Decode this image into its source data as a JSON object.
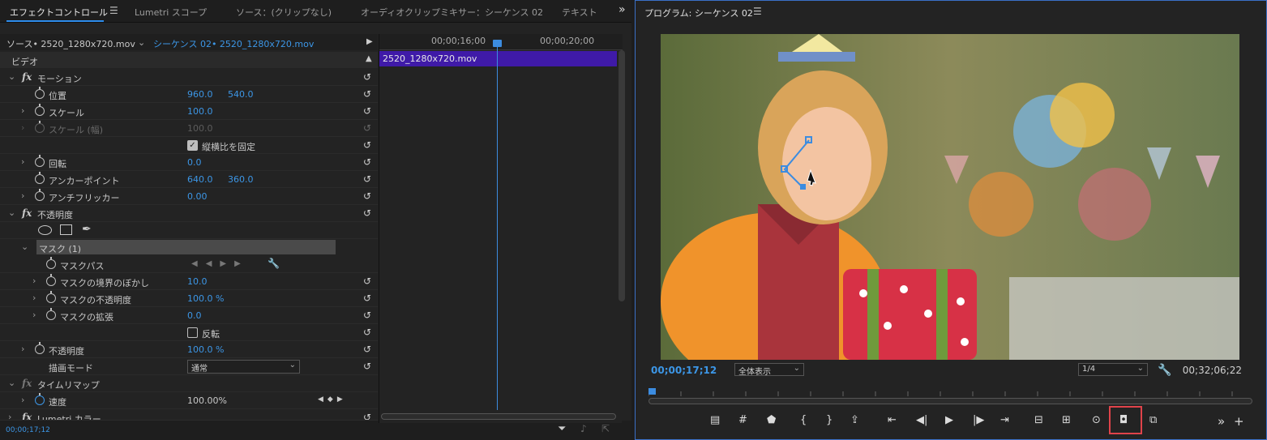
{
  "tabs": {
    "effect_controls": "エフェクトコントロール",
    "lumetri_scope": "Lumetri スコープ",
    "source": "ソース：(クリップなし)",
    "audio_mixer": "オーディオクリップミキサー：シーケンス 02",
    "text": "テキスト",
    "more": "»"
  },
  "source_row": {
    "source": "ソース• 2520_1280x720.mov",
    "sequence": "シーケンス 02• 2520_1280x720.mov"
  },
  "video_header": "ビデオ",
  "params": {
    "motion": "モーション",
    "position": "位置",
    "position_x": "960.0",
    "position_y": "540.0",
    "scale": "スケール",
    "scale_val": "100.0",
    "scale_width": "スケール (幅)",
    "scale_width_val": "100.0",
    "uniform_scale": "縦横比を固定",
    "rotation": "回転",
    "rotation_val": "0.0",
    "anchor": "アンカーポイント",
    "anchor_x": "640.0",
    "anchor_y": "360.0",
    "anti_flicker": "アンチフリッカー",
    "anti_flicker_val": "0.00",
    "opacity_group": "不透明度",
    "mask": "マスク (1)",
    "mask_path": "マスクパス",
    "mask_feather": "マスクの境界のぼかし",
    "mask_feather_val": "10.0",
    "mask_opacity": "マスクの不透明度",
    "mask_opacity_val": "100.0 %",
    "mask_expansion": "マスクの拡張",
    "mask_expansion_val": "0.0",
    "inverted": "反転",
    "opacity": "不透明度",
    "opacity_val": "100.0 %",
    "blend_mode": "描画モード",
    "blend_mode_val": "通常",
    "time_remap": "タイムリマップ",
    "speed": "速度",
    "speed_val": "100.00%",
    "lumetri": "Lumetri カラー"
  },
  "timeline": {
    "tc1": "00;00;16;00",
    "tc2": "00;00;20;00",
    "clip": "2520_1280x720.mov"
  },
  "bottom_timecode": "00;00;17;12",
  "monitor": {
    "title": "プログラム: シーケンス 02",
    "current_tc": "00;00;17;12",
    "zoom": "全体表示",
    "resolution": "1/4",
    "duration": "00;32;06;22"
  },
  "colors": {
    "accent": "#3c96e6",
    "clip": "#3f1aa8",
    "highlight": "#e0434a"
  }
}
